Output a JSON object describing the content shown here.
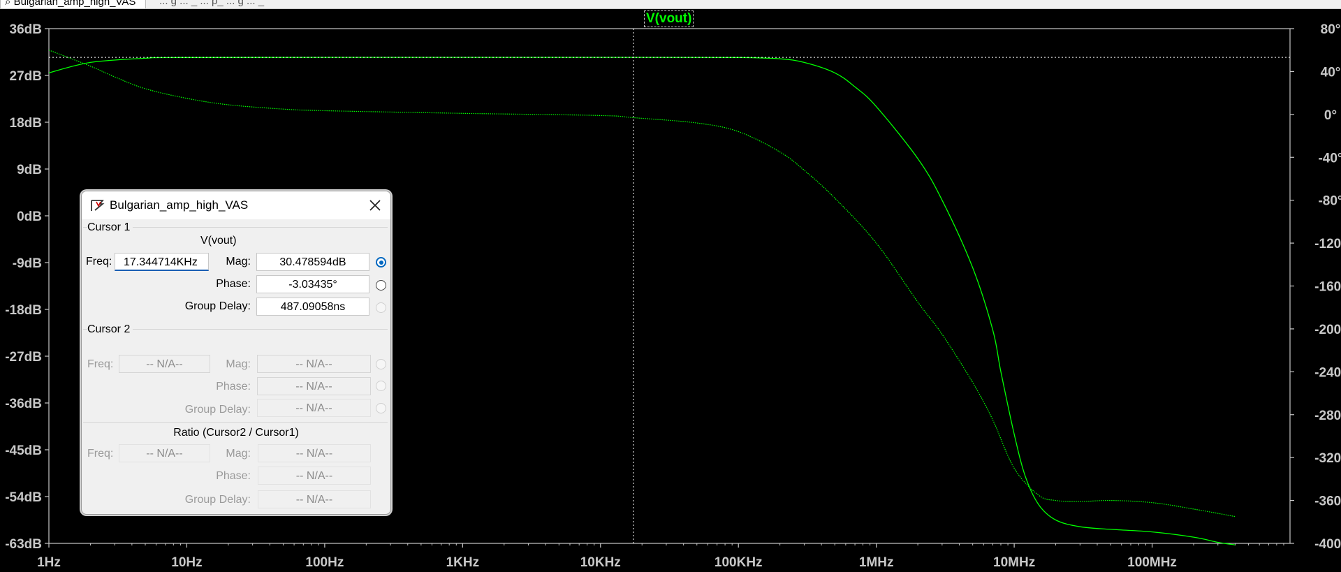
{
  "window": {
    "tab_title": "Bulgarian_amp_high_VAS",
    "tab_title_partial": "... g ... _ ... p_ ... g ... _"
  },
  "plot": {
    "trace_label": "V(vout)",
    "colors": {
      "background": "#000000",
      "trace": "#00ff00",
      "axis": "#c8c8c8"
    }
  },
  "chart_data": {
    "type": "line",
    "title": "V(vout)",
    "x_scale": "log",
    "x_range": [
      1,
      1000000000
    ],
    "x_ticks": [
      {
        "value": 1,
        "label": "1Hz"
      },
      {
        "value": 10,
        "label": "10Hz"
      },
      {
        "value": 100,
        "label": "100Hz"
      },
      {
        "value": 1000,
        "label": "1KHz"
      },
      {
        "value": 10000,
        "label": "10KHz"
      },
      {
        "value": 100000,
        "label": "100KHz"
      },
      {
        "value": 1000000,
        "label": "1MHz"
      },
      {
        "value": 10000000,
        "label": "10MHz"
      },
      {
        "value": 100000000,
        "label": "100MHz"
      }
    ],
    "y_left_range": [
      -63,
      36
    ],
    "y_left_ticks": [
      {
        "value": 36,
        "label": "36dB"
      },
      {
        "value": 27,
        "label": "27dB"
      },
      {
        "value": 18,
        "label": "18dB"
      },
      {
        "value": 9,
        "label": "9dB"
      },
      {
        "value": 0,
        "label": "0dB"
      },
      {
        "value": -9,
        "label": "-9dB"
      },
      {
        "value": -18,
        "label": "-18dB"
      },
      {
        "value": -27,
        "label": "-27dB"
      },
      {
        "value": -36,
        "label": "-36dB"
      },
      {
        "value": -45,
        "label": "-45dB"
      },
      {
        "value": -54,
        "label": "-54dB"
      },
      {
        "value": -63,
        "label": "-63dB"
      }
    ],
    "y_right_range": [
      -400,
      80
    ],
    "y_right_ticks": [
      {
        "value": 80,
        "label": "80°"
      },
      {
        "value": 40,
        "label": "40°"
      },
      {
        "value": 0,
        "label": "0°"
      },
      {
        "value": -40,
        "label": "-40°"
      },
      {
        "value": -80,
        "label": "-80°"
      },
      {
        "value": -120,
        "label": "-120°"
      },
      {
        "value": -160,
        "label": "-160°"
      },
      {
        "value": -200,
        "label": "-200°"
      },
      {
        "value": -240,
        "label": "-240°"
      },
      {
        "value": -280,
        "label": "-280°"
      },
      {
        "value": -320,
        "label": "-320°"
      },
      {
        "value": -360,
        "label": "-360°"
      },
      {
        "value": -400,
        "label": "-400°"
      }
    ],
    "series": [
      {
        "axis": "left",
        "style": "solid",
        "points": [
          [
            1,
            27.5
          ],
          [
            2,
            29.5
          ],
          [
            5,
            30.3
          ],
          [
            10,
            30.45
          ],
          [
            1000,
            30.48
          ],
          [
            17344.714,
            30.478594
          ],
          [
            100000,
            30.45
          ],
          [
            200000,
            30.2
          ],
          [
            300000,
            29.5
          ],
          [
            500000,
            27.5
          ],
          [
            700000,
            24.8
          ],
          [
            1000000,
            21
          ],
          [
            2000000,
            11
          ],
          [
            3000000,
            3
          ],
          [
            5000000,
            -10
          ],
          [
            7000000,
            -22
          ],
          [
            8000000,
            -30
          ],
          [
            10000000,
            -42
          ],
          [
            12000000,
            -50
          ],
          [
            15000000,
            -55.5
          ],
          [
            20000000,
            -58.5
          ],
          [
            30000000,
            -59.8
          ],
          [
            50000000,
            -60.3
          ],
          [
            100000000,
            -60.8
          ],
          [
            200000000,
            -61.8
          ],
          [
            300000000,
            -62.8
          ],
          [
            400000000,
            -63.3
          ]
        ]
      },
      {
        "axis": "right",
        "style": "dotted",
        "points": [
          [
            1,
            60
          ],
          [
            2,
            45
          ],
          [
            3,
            35
          ],
          [
            5,
            24
          ],
          [
            10,
            15
          ],
          [
            20,
            9
          ],
          [
            50,
            5
          ],
          [
            100,
            3.5
          ],
          [
            1000,
            1
          ],
          [
            10000,
            -1
          ],
          [
            17344.714,
            -3.03435
          ],
          [
            50000,
            -8
          ],
          [
            100000,
            -16
          ],
          [
            200000,
            -35
          ],
          [
            300000,
            -52
          ],
          [
            500000,
            -78
          ],
          [
            1000000,
            -120
          ],
          [
            2000000,
            -175
          ],
          [
            3000000,
            -205
          ],
          [
            5000000,
            -250
          ],
          [
            7000000,
            -285
          ],
          [
            10000000,
            -330
          ],
          [
            15000000,
            -355
          ],
          [
            20000000,
            -360
          ],
          [
            30000000,
            -361
          ],
          [
            50000000,
            -360
          ],
          [
            100000000,
            -362
          ],
          [
            200000000,
            -368
          ],
          [
            400000000,
            -375
          ]
        ]
      }
    ],
    "reference_lines": {
      "horizontal_db": 30.478594,
      "vertical_hz": 17344.714
    }
  },
  "cursor_dialog": {
    "title": "Bulgarian_amp_high_VAS",
    "cursor1": {
      "header": "Cursor 1",
      "trace": "V(vout)",
      "freq_label": "Freq:",
      "freq_value": "17.344714KHz",
      "mag_label": "Mag:",
      "mag_value": "30.478594dB",
      "phase_label": "Phase:",
      "phase_value": "-3.03435°",
      "gd_label": "Group Delay:",
      "gd_value": "487.09058ns"
    },
    "cursor2": {
      "header": "Cursor 2",
      "freq_label": "Freq:",
      "freq_value": "-- N/A--",
      "mag_label": "Mag:",
      "mag_value": "-- N/A--",
      "phase_label": "Phase:",
      "phase_value": "-- N/A--",
      "gd_label": "Group Delay:",
      "gd_value": "-- N/A--"
    },
    "ratio": {
      "header": "Ratio (Cursor2 / Cursor1)",
      "freq_label": "Freq:",
      "freq_value": "-- N/A--",
      "mag_label": "Mag:",
      "mag_value": "-- N/A--",
      "phase_label": "Phase:",
      "phase_value": "-- N/A--",
      "gd_label": "Group Delay:",
      "gd_value": "-- N/A--"
    }
  }
}
